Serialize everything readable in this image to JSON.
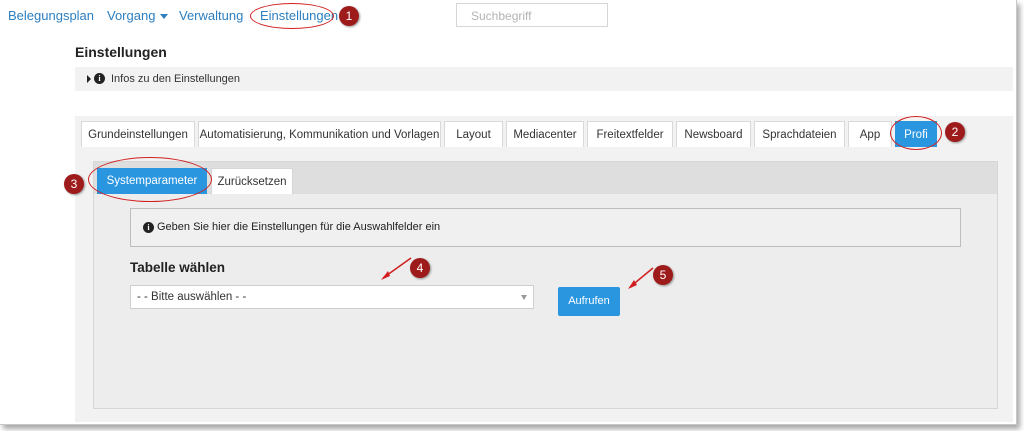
{
  "nav": {
    "items": [
      {
        "label": "Belegungsplan"
      },
      {
        "label": "Vorgang"
      },
      {
        "label": "Verwaltung"
      },
      {
        "label": "Einstellungen"
      }
    ],
    "search_placeholder": "Suchbegriff"
  },
  "page": {
    "title": "Einstellungen",
    "info_label": "Infos zu den Einstellungen"
  },
  "tabs": [
    {
      "label": "Grundeinstellungen"
    },
    {
      "label": "Automatisierung, Kommunikation und Vorlagen"
    },
    {
      "label": "Layout"
    },
    {
      "label": "Mediacenter"
    },
    {
      "label": "Freitextfelder"
    },
    {
      "label": "Newsboard"
    },
    {
      "label": "Sprachdateien"
    },
    {
      "label": "App"
    },
    {
      "label": "Profi",
      "active": true
    }
  ],
  "subtabs": [
    {
      "label": "Systemparameter",
      "active": true
    },
    {
      "label": "Zurücksetzen"
    }
  ],
  "content": {
    "notice": "Geben Sie hier die Einstellungen für die Auswahlfelder ein",
    "section_heading": "Tabelle wählen",
    "select_value": "- - Bitte auswählen - -",
    "submit_label": "Aufrufen"
  },
  "annotations": {
    "badges": [
      "1",
      "2",
      "3",
      "4",
      "5"
    ],
    "color": "#d11f1f",
    "badge_color": "#9e1b1b"
  },
  "colors": {
    "accent": "#2b96e0",
    "link": "#2d7fc0"
  }
}
